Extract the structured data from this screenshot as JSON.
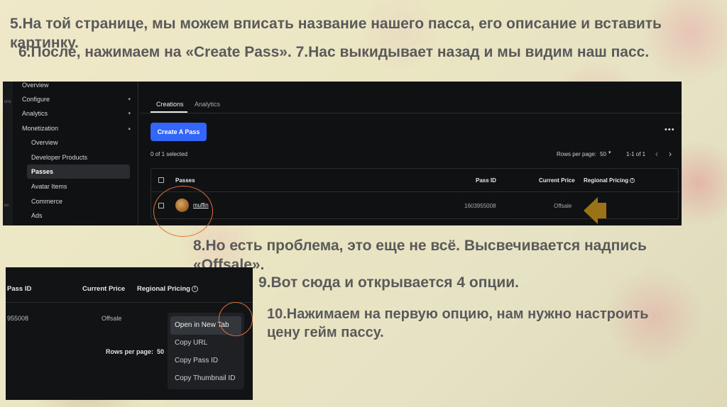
{
  "slide": {
    "step5_text": "5.На той странице, мы можем вписать название нашего пасса, его описание и вставить картинку.",
    "step7_text": "6.После, нажимаем на «Create Pass». 7.Нас выкидывает назад и мы видим наш пасс.",
    "step8_text": "8.Но есть проблема, это еще не всё. Высвечивается надпись «Offsale».",
    "step9_text": "9.Вот сюда и открывается 4 опции.",
    "step10_text": "10.Нажимаем на первую опцию, нам нужно настроить цену гейм пассу."
  },
  "sidebar": {
    "edge_glyphs": [
      "ons",
      "es"
    ],
    "items": [
      {
        "label": "Overview"
      },
      {
        "label": "Configure"
      },
      {
        "label": "Analytics"
      },
      {
        "label": "Monetization"
      },
      {
        "label": "Overview"
      },
      {
        "label": "Developer Products"
      },
      {
        "label": "Passes"
      },
      {
        "label": "Avatar Items"
      },
      {
        "label": "Commerce"
      },
      {
        "label": "Ads"
      }
    ]
  },
  "main": {
    "tabs": [
      {
        "label": "Creations"
      },
      {
        "label": "Analytics"
      }
    ],
    "create_button": "Create A Pass",
    "more_menu": "•••",
    "selection_count": "0 of 1 selected",
    "rows_per_page_label": "Rows per page:",
    "rows_per_page_value": "50",
    "pagination_range": "1-1 of 1",
    "prev": "‹",
    "next": "›",
    "table": {
      "headers": [
        "Passes",
        "Pass ID",
        "Current Price",
        "Regional Pricing"
      ],
      "rows": [
        {
          "name": "muffin",
          "pass_id": "1603955008",
          "price": "Offsale"
        }
      ]
    }
  },
  "popup": {
    "headers": [
      "Pass ID",
      "Current Price",
      "Regional Pricing"
    ],
    "row": {
      "pass_id": "955008",
      "price": "Offsale"
    },
    "rows_per_page_label": "Rows per page:",
    "rows_per_page_value": "50",
    "menu_items": [
      "Open in New Tab",
      "Copy URL",
      "Copy Pass ID",
      "Copy Thumbnail ID"
    ]
  },
  "colors": {
    "accent_button": "#3366ff",
    "annotation_circle": "#e0703a",
    "annotation_arrow": "#9a7414"
  }
}
